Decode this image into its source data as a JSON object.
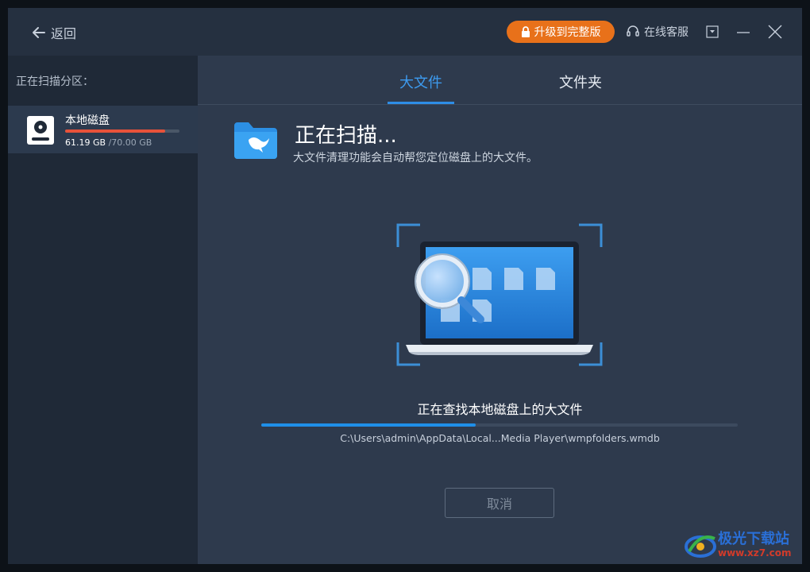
{
  "header": {
    "back_label": "返回",
    "upgrade_label": "升级到完整版",
    "support_label": "在线客服"
  },
  "sidebar": {
    "title": "正在扫描分区：",
    "drive": {
      "name": "本地磁盘",
      "used": "61.19 GB",
      "total": "/70.00 GB",
      "usage_fraction": 0.874
    }
  },
  "tabs": [
    {
      "label": "大文件",
      "active": true
    },
    {
      "label": "文件夹",
      "active": false
    }
  ],
  "scan": {
    "title": "正在扫描...",
    "description": "大文件清理功能会自动帮您定位磁盘上的大文件。",
    "status": "正在查找本地磁盘上的大文件",
    "progress_fraction": 0.45,
    "current_path": "C:\\Users\\admin\\AppData\\Local...Media Player\\wmpfolders.wmdb",
    "cancel_label": "取消"
  },
  "watermark": {
    "name": "极光下载站",
    "url": "www.xz7.com"
  },
  "colors": {
    "accent": "#2e8de6",
    "upgrade": "#e8711a",
    "usage_bar": "#e8523a"
  }
}
